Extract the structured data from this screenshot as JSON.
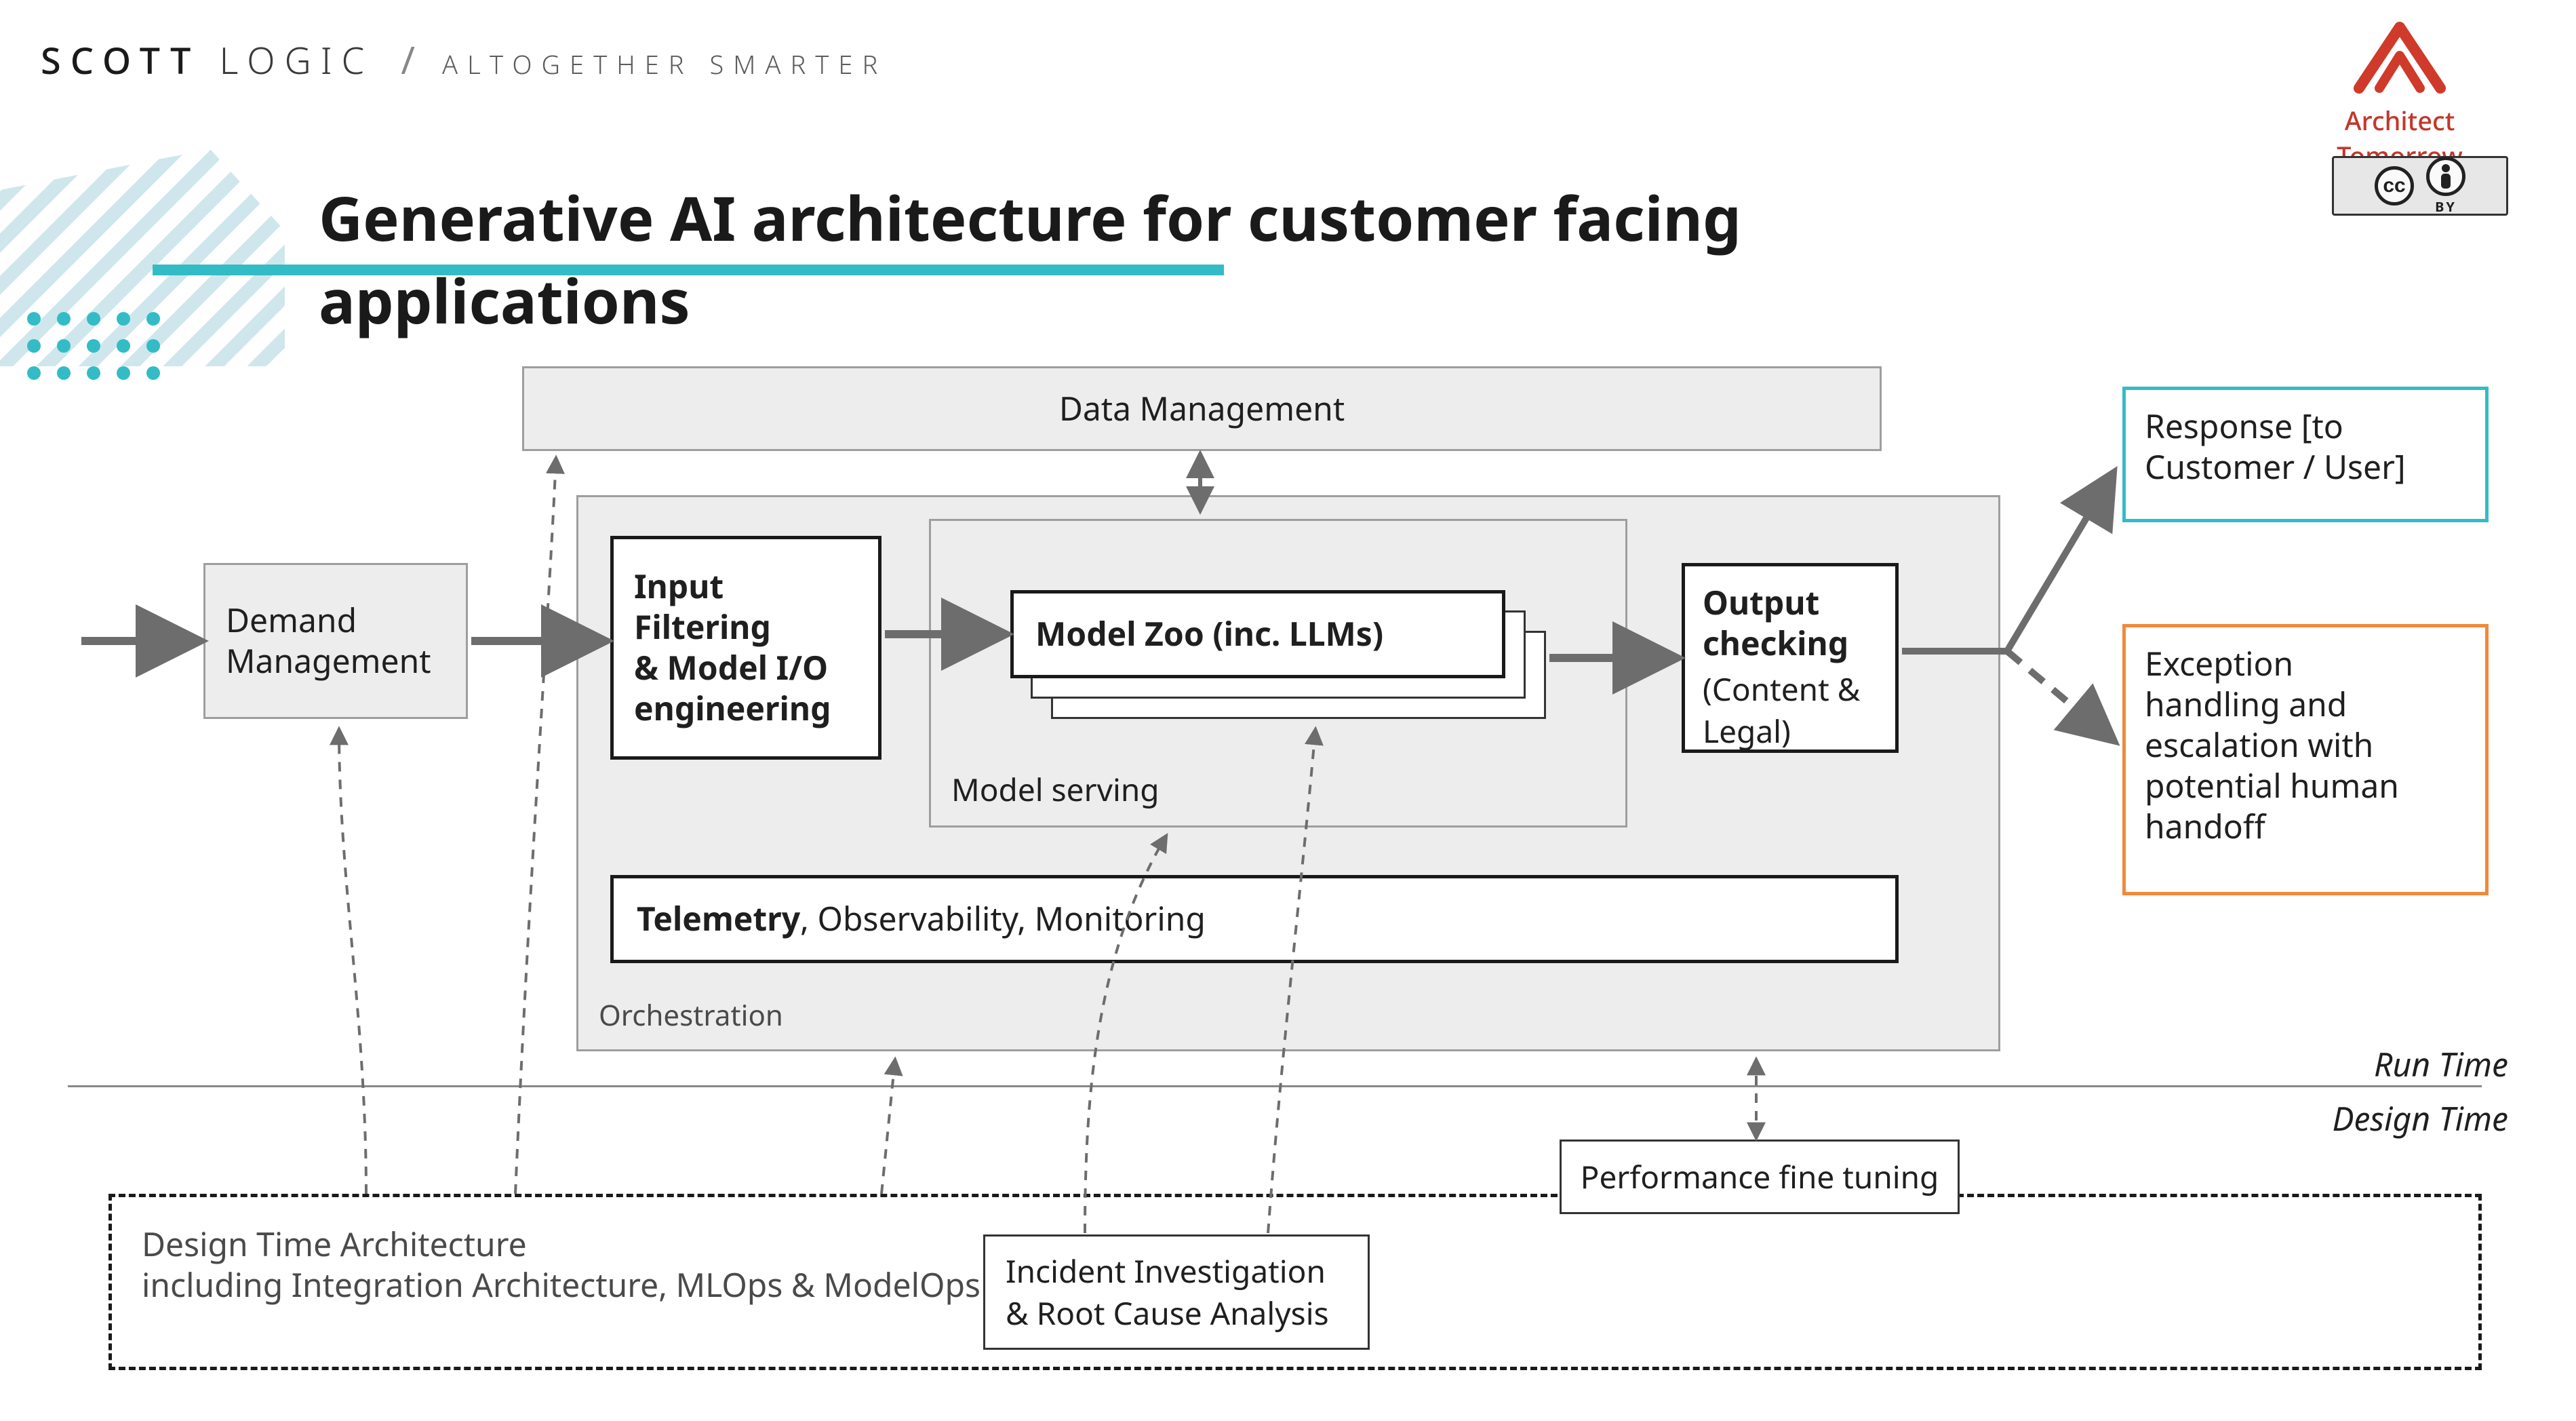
{
  "brand": {
    "name_bold": "SCOTT",
    "name_rest": "LOGIC",
    "sep": "/",
    "tag": "ALTOGETHER SMARTER"
  },
  "right_logo": {
    "name": "Architect Tomorrow"
  },
  "cc_badge": {
    "cc": "cc",
    "by": "BY"
  },
  "title": "Generative AI architecture for customer facing applications",
  "top_bar": {
    "data_mgmt": "Data Management"
  },
  "left": {
    "demand_mgmt": "Demand\nManagement"
  },
  "orchestration": {
    "label": "Orchestration",
    "input_filter": "Input\nFiltering\n& Model I/O\nengineering",
    "model_serving": "Model serving",
    "model_zoo": "Model Zoo (inc. LLMs)",
    "output_checking_title": "Output\nchecking",
    "output_checking_sub": "(Content &\nLegal)",
    "telemetry_bold": "Telemetry",
    "telemetry_rest": ", Observability, Monitoring"
  },
  "right_outputs": {
    "response": "Response [to\nCustomer / User]",
    "exception": "Exception\nhandling and\nescalation with\npotential human\nhandoff"
  },
  "zones": {
    "runtime": "Run Time",
    "designtime": "Design Time"
  },
  "design": {
    "container_l1": "Design Time Architecture",
    "container_l2": "including Integration Architecture, MLOps & ModelOps",
    "incident": "Incident Investigation\n& Root Cause Analysis",
    "perf": "Performance fine tuning"
  }
}
